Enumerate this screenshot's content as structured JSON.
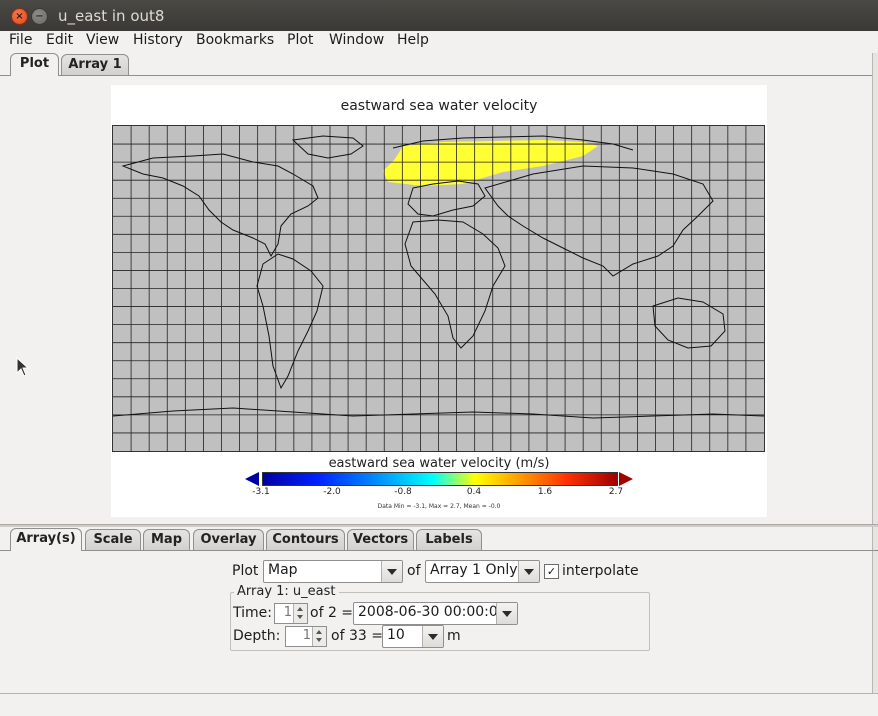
{
  "window": {
    "title": "u_east in out8",
    "close_glyph": "×",
    "minimize_glyph": "−"
  },
  "menu": [
    "File",
    "Edit",
    "View",
    "History",
    "Bookmarks",
    "Plot",
    "Window",
    "Help"
  ],
  "top_tabs": [
    {
      "label": "Plot",
      "active": true
    },
    {
      "label": "Array 1",
      "active": false
    }
  ],
  "plot": {
    "title": "eastward sea water velocity",
    "colorbar": {
      "title": "eastward sea water velocity (m/s)",
      "ticks": [
        "-3.1",
        "-2.0",
        "-0.8",
        "0.4",
        "1.6",
        "2.7"
      ],
      "stats": "Data Min = -3.1, Max = 2.7, Mean = -0.0"
    },
    "map_background": "#c0c0c0",
    "highlight_color": "#ffff33"
  },
  "bottom_tabs": [
    {
      "label": "Array(s)",
      "active": true
    },
    {
      "label": "Scale",
      "active": false
    },
    {
      "label": "Map",
      "active": false
    },
    {
      "label": "Overlay",
      "active": false
    },
    {
      "label": "Contours",
      "active": false
    },
    {
      "label": "Vectors",
      "active": false
    },
    {
      "label": "Labels",
      "active": false
    }
  ],
  "controls": {
    "plot_label": "Plot",
    "plot_type": "Map",
    "of_label": "of",
    "array_mode": "Array 1 Only",
    "interpolate_label": "interpolate",
    "interpolate_checked": true,
    "check_glyph": "✓",
    "group_title": "Array 1: u_east",
    "time_label": "Time:",
    "time_index": "1",
    "time_of": "of 2 =",
    "time_value": "2008-06-30 00:00:00",
    "depth_label": "Depth:",
    "depth_index": "1",
    "depth_of": "of 33 =",
    "depth_value": "10",
    "depth_unit": "m"
  }
}
